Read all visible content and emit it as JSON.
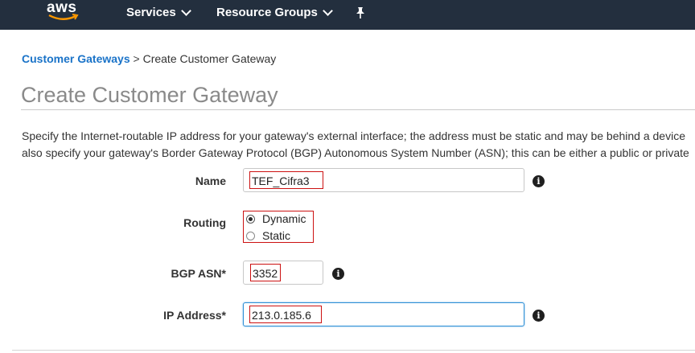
{
  "nav": {
    "logo": "aws",
    "services": "Services",
    "resource_groups": "Resource Groups",
    "pin_icon": "pin-icon"
  },
  "breadcrumb": {
    "parent": "Customer Gateways",
    "separator": ">",
    "current": "Create Customer Gateway"
  },
  "page": {
    "title": "Create Customer Gateway",
    "description_line1": "Specify the Internet-routable IP address for your gateway's external interface; the address must be static and may be behind a device",
    "description_line2": "also specify your gateway's Border Gateway Protocol (BGP) Autonomous System Number (ASN); this can be either a public or private"
  },
  "form": {
    "name_label": "Name",
    "name_value": "TEF_Cifra3",
    "routing_label": "Routing",
    "routing_options": [
      "Dynamic",
      "Static"
    ],
    "routing_selected": "Dynamic",
    "bgp_label": "BGP ASN*",
    "bgp_value": "3352",
    "ip_label": "IP Address*",
    "ip_value": "213.0.185.6"
  },
  "colors": {
    "nav_bg": "#232f3e",
    "link": "#1a73c8",
    "highlight": "#cc1111",
    "focus": "#2d8fd6"
  }
}
